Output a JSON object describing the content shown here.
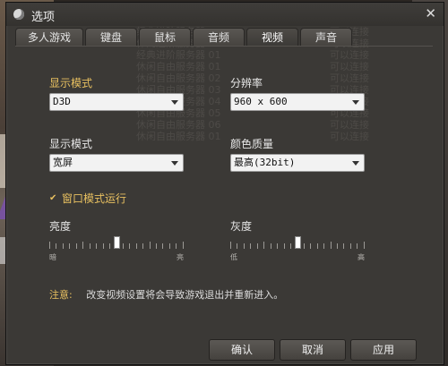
{
  "window": {
    "title": "选项",
    "close_glyph": "✕"
  },
  "tabs": [
    {
      "label": "多人游戏"
    },
    {
      "label": "键盘"
    },
    {
      "label": "鼠标"
    },
    {
      "label": "音频"
    },
    {
      "label": "视频",
      "active": true
    },
    {
      "label": "声音"
    }
  ],
  "video": {
    "mode_label": "显示模式",
    "mode_value": "D3D",
    "resolution_label": "分辨率",
    "resolution_value": "960 x 600",
    "aspect_label": "显示模式",
    "aspect_value": "宽屏",
    "color_label": "颜色质量",
    "color_value": "最高(32bit)",
    "windowed_label": "窗口模式运行",
    "windowed_checked": true,
    "check_glyph": "✔",
    "brightness": {
      "label": "亮度",
      "min_label": "暗",
      "max_label": "亮",
      "level": 0.5
    },
    "gamma": {
      "label": "灰度",
      "min_label": "低",
      "max_label": "高",
      "level": 0.5
    }
  },
  "note": {
    "label": "注意:",
    "text": "改变视频设置将会导致游戏退出并重新进入。"
  },
  "buttons": {
    "ok": "确认",
    "cancel": "取消",
    "apply": "应用"
  },
  "watermark_rows": [
    [
      "经典自由服务器 01",
      "可以连接"
    ],
    [
      "休闲进阶服务器 02",
      "可以连接"
    ],
    [
      "经典进阶服务器 03",
      "可以连接"
    ],
    [
      "休闲进阶服务器 01",
      "可以连接"
    ],
    [
      "经典进阶服务器 01",
      "可以连接"
    ],
    [
      "休闲自由服务器 01",
      "可以连接"
    ],
    [
      "休闲自由服务器 02",
      "可以连接"
    ],
    [
      "休闲自由服务器 03",
      "可以连接"
    ],
    [
      "休闲自由服务器 04",
      "可以连接"
    ],
    [
      "休闲自由服务器 05",
      "可以连接"
    ],
    [
      "休闲自由服务器 06",
      "可以连接"
    ],
    [
      "休闲自由服务器 01",
      "可以连接"
    ]
  ],
  "colors": {
    "accent": "#e8c060",
    "dialog_bg": "#3b3936",
    "select_bg": "#f2f2f2"
  }
}
